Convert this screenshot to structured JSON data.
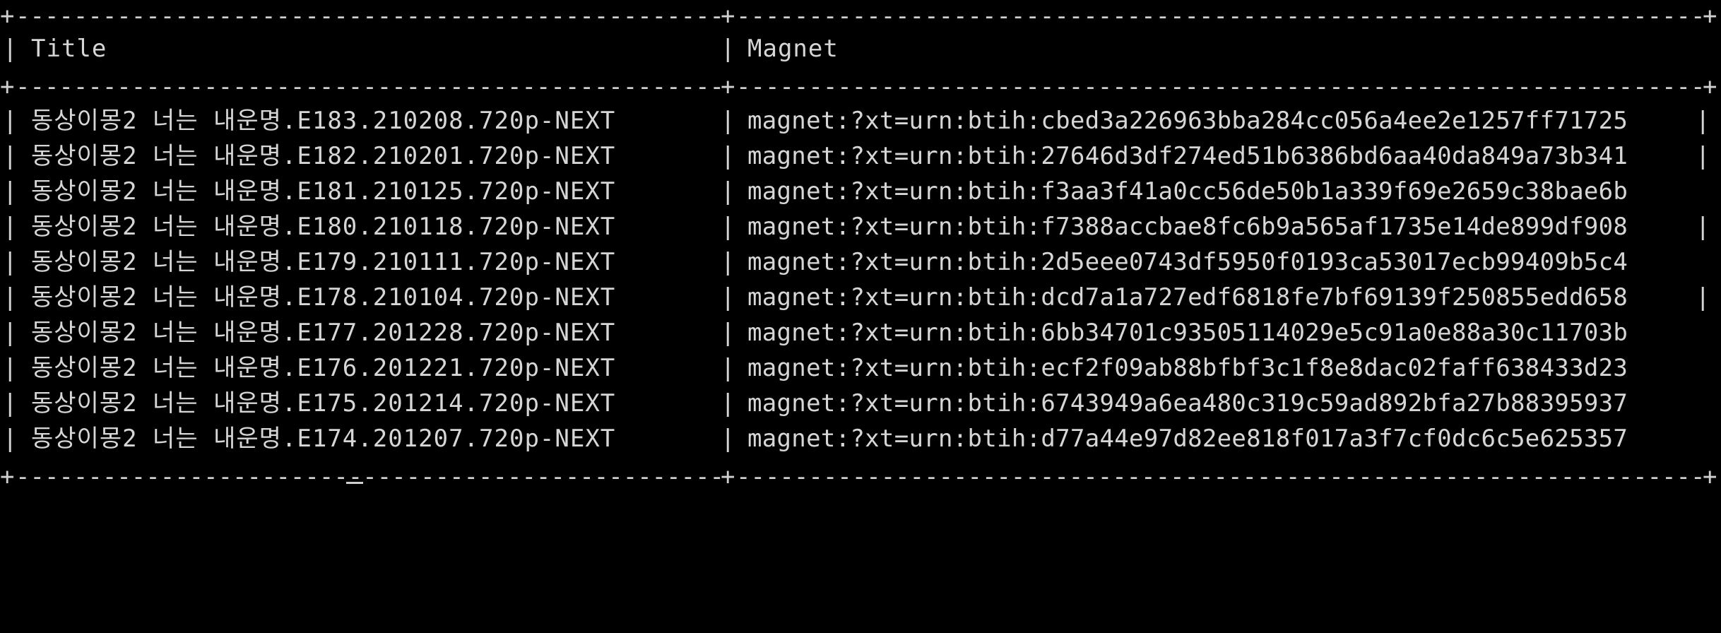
{
  "table": {
    "headers": {
      "title": "Title",
      "magnet": "Magnet"
    },
    "border_char": "+",
    "dash_char": "-",
    "pipe_char": "|",
    "rows": [
      {
        "title": "동상이몽2 너는 내운명.E183.210208.720p-NEXT",
        "magnet": "magnet:?xt=urn:btih:cbed3a226963bba284cc056a4ee2e1257ff71725"
      },
      {
        "title": "동상이몽2 너는 내운명.E182.210201.720p-NEXT",
        "magnet": "magnet:?xt=urn:btih:27646d3df274ed51b6386bd6aa40da849a73b341"
      },
      {
        "title": "동상이몽2 너는 내운명.E181.210125.720p-NEXT",
        "magnet": "magnet:?xt=urn:btih:f3aa3f41a0cc56de50b1a339f69e2659c38bae6b"
      },
      {
        "title": "동상이몽2 너는 내운명.E180.210118.720p-NEXT",
        "magnet": "magnet:?xt=urn:btih:f7388accbae8fc6b9a565af1735e14de899df908"
      },
      {
        "title": "동상이몽2 너는 내운명.E179.210111.720p-NEXT",
        "magnet": "magnet:?xt=urn:btih:2d5eee0743df5950f0193ca53017ecb99409b5c4"
      },
      {
        "title": "동상이몽2 너는 내운명.E178.210104.720p-NEXT",
        "magnet": "magnet:?xt=urn:btih:dcd7a1a727edf6818fe7bf69139f250855edd658"
      },
      {
        "title": "동상이몽2 너는 내운명.E177.201228.720p-NEXT",
        "magnet": "magnet:?xt=urn:btih:6bb34701c93505114029e5c91a0e88a30c11703b"
      },
      {
        "title": "동상이몽2 너는 내운명.E176.201221.720p-NEXT",
        "magnet": "magnet:?xt=urn:btih:ecf2f09ab88bfbf3c1f8e8dac02faff638433d23"
      },
      {
        "title": "동상이몽2 너는 내운명.E175.201214.720p-NEXT",
        "magnet": "magnet:?xt=urn:btih:6743949a6ea480c319c59ad892bfa27b88395937"
      },
      {
        "title": "동상이몽2 너는 내운명.E174.201207.720p-NEXT",
        "magnet": "magnet:?xt=urn:btih:d77a44e97d82ee818f017a3f7cf0dc6c5e625357"
      }
    ]
  },
  "colors": {
    "background": "#000000",
    "text": "#d6d6d6"
  }
}
